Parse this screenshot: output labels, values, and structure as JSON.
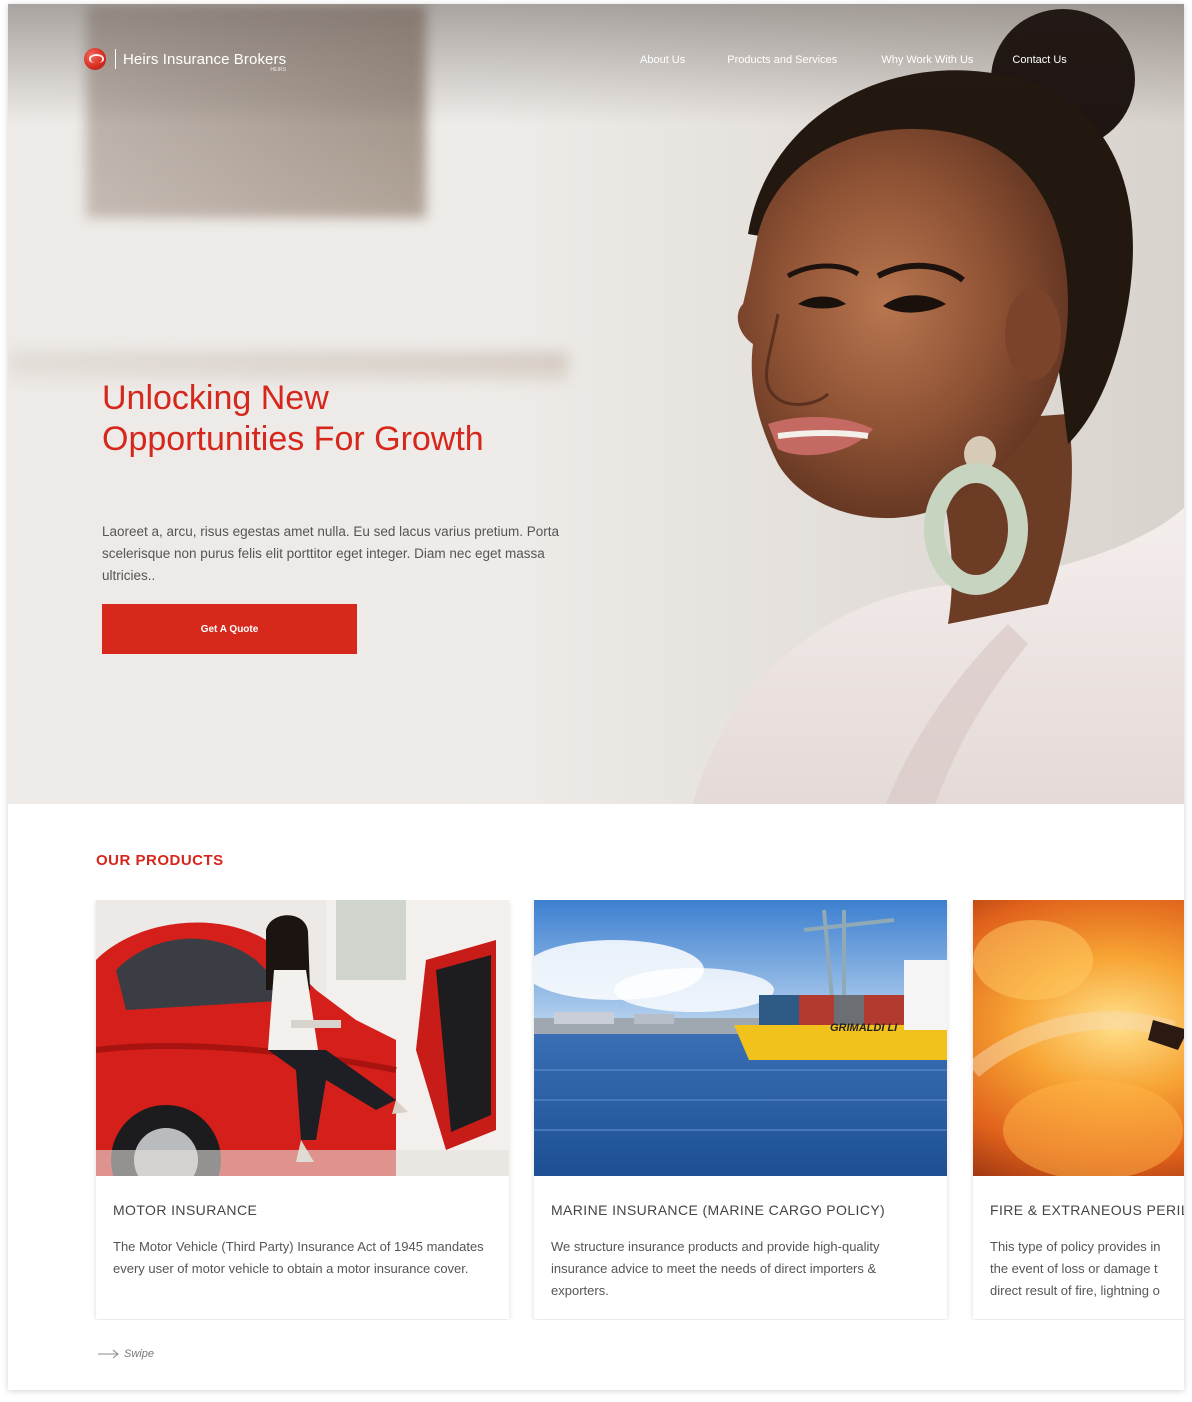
{
  "brand": {
    "name": "Heirs Insurance Brokers",
    "sub": "HEIRS",
    "logo_icon": "globe-logo-icon",
    "accent": "#d6271c"
  },
  "nav": {
    "items": [
      {
        "label": "About Us"
      },
      {
        "label": "Products and Services"
      },
      {
        "label": "Why Work With Us"
      },
      {
        "label": "Contact Us"
      }
    ]
  },
  "hero": {
    "title": "Unlocking New Opportunities For Growth",
    "description": "Laoreet a, arcu, risus egestas amet nulla. Eu sed lacus varius pretium. Porta scelerisque non purus felis elit porttitor eget integer. Diam nec eget massa ultricies..",
    "cta_label": "Get A Quote"
  },
  "products": {
    "section_title": "OUR PRODUCTS",
    "items": [
      {
        "title": "MOTOR INSURANCE",
        "text": "The Motor Vehicle (Third Party) Insurance Act of 1945 mandates every user of motor vehicle to obtain a motor insurance cover."
      },
      {
        "title": "MARINE INSURANCE (MARINE CARGO POLICY)",
        "text": "We structure insurance products and provide high-quality insurance advice to meet the needs of direct importers & exporters."
      },
      {
        "title": "FIRE & EXTRANEOUS PERILS",
        "text_lines": [
          "This type of policy provides in",
          "the event of loss or damage t",
          "direct result of fire, lightning o"
        ]
      }
    ],
    "ship_text": "GRIMALDI LI",
    "swipe_label": "Swipe"
  }
}
